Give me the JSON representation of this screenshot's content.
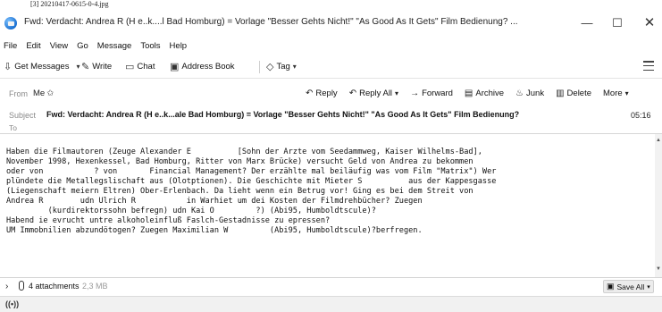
{
  "caption": "[3] 20210417-0615-0-4.jpg",
  "window": {
    "title": "Fwd: Verdacht: Andrea R          (H  e..k....l Bad Homburg) = Vorlage \"Besser Gehts Nicht!\" \"As Good As It Gets\" Film Bedienung? ...",
    "minimize": "—",
    "maximize": "☐",
    "close": "✕"
  },
  "menu": {
    "file": "File",
    "edit": "Edit",
    "view": "View",
    "go": "Go",
    "message": "Message",
    "tools": "Tools",
    "help": "Help"
  },
  "toolbar": {
    "get_messages": "Get Messages",
    "write": "Write",
    "chat": "Chat",
    "address_book": "Address Book",
    "tag": "Tag"
  },
  "header": {
    "from_label": "From",
    "from_value": "Me",
    "subject_label": "Subject",
    "subject_value": "Fwd: Verdacht: Andrea R          (H  e..k...ale        Bad Homburg) = Vorlage \"Besser Gehts Nicht!\" \"As Good As It Gets\" Film Bedienung?",
    "date": "05:16",
    "to_label": "To",
    "actions": {
      "reply": "Reply",
      "reply_all": "Reply All",
      "forward": "Forward",
      "archive": "Archive",
      "junk": "Junk",
      "delete": "Delete",
      "more": "More"
    }
  },
  "body": {
    "lines": [
      "Haben die Filmautoren (Zeuge Alexander E          [Sohn der Ärzte vom Seedammweg, Kaiser Wilhelms-Bad],",
      "November 1998, Hexenkessel, Bad Homburg, Ritter von Marx Brücke) versucht Geld von Andrea zu bekommen",
      "oder von           ? von       Financial Management? Der erzählte mal beiläufig was vom Film \"Matrix\") Wer",
      "plündete die Metallegslischaft aus (Ölotptionen). Die Geschichte mit Mieter S          aus der Kappesgasse",
      "(Liegenschaft meiern Eltren) Ober-Erlenbach. Da lieht wenn ein Betrug vor! Ging es bei dem Streit von",
      "Andrea R        udn Ulrich R           in Warhiet um dei Kosten der Filmdrehbücher? Zuegen",
      "         (kurdirektorssohn befregn) udn Kai O         ?) (Abi95, Humboldtscule)?",
      "Habend ie evrucht untre alkoholeinfluß Faslch-Gestadnisse zu epressen?",
      "UM Immobnilien abzundötogen? Zuegen Maximilian W         (Abi95, Humboldtscule)?berfregen."
    ]
  },
  "attachments": {
    "count": "4 attachments",
    "size": "2,3 MB",
    "save_all": "Save All"
  },
  "status": {
    "icon_text": "((•))"
  }
}
